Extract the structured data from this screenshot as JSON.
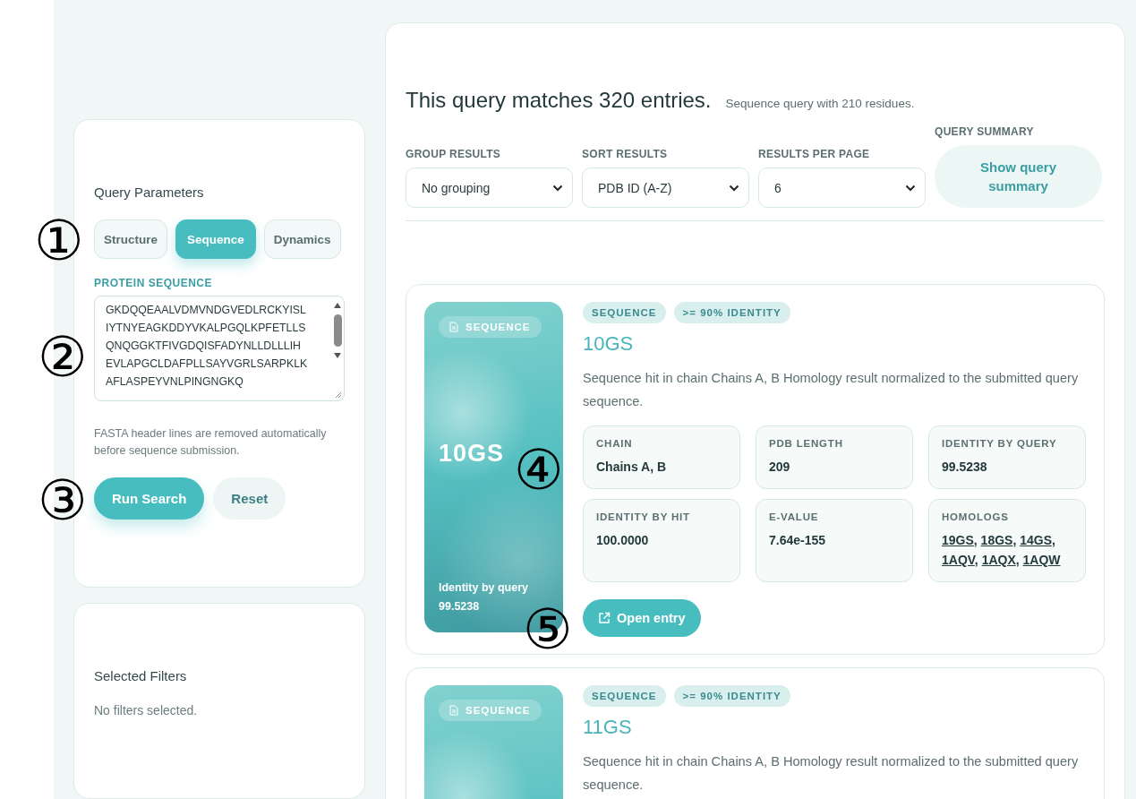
{
  "annotations": [
    "①",
    "②",
    "③",
    "④",
    "⑤"
  ],
  "query_panel": {
    "title": "Query Parameters",
    "modes": [
      {
        "label": "Structure",
        "selected": false
      },
      {
        "label": "Sequence",
        "selected": true
      },
      {
        "label": "Dynamics",
        "selected": false
      }
    ],
    "sequence_label": "PROTEIN SEQUENCE",
    "sequence_lines": [
      "GKDQQEAALVDMVNDGVEDLRCKYISL",
      "IYTNYEAGKDDYVKALPGQLKPFETLLS",
      "QNQGGKTFIVGDQISFADYNLLDLLLIH",
      "EVLAPGCLDAFPLLSAYVGRLSARPKLK",
      "AFLASPEYVNLPINGNGKQ"
    ],
    "hint": "FASTA header lines are removed automatically before sequence submission.",
    "buttons": [
      {
        "label": "Run Search",
        "kind": "primary"
      },
      {
        "label": "Reset",
        "kind": "secondary"
      }
    ]
  },
  "filters_panel": {
    "title": "Selected Filters",
    "empty_text": "No filters selected."
  },
  "results": {
    "headline": "This query matches 320 entries.",
    "subline": "Sequence query with 210 residues.",
    "controls": [
      {
        "label": "GROUP RESULTS",
        "value": "No grouping"
      },
      {
        "label": "SORT RESULTS",
        "value": "PDB ID (A-Z)"
      },
      {
        "label": "RESULTS PER PAGE",
        "value": "6"
      }
    ],
    "summary": {
      "label": "QUERY SUMMARY",
      "button": "Show query summary"
    },
    "entries": [
      {
        "art_badge": "SEQUENCE",
        "art_id": "10GS",
        "art_caption": "Identity by query",
        "art_value": "99.5238",
        "tags": [
          "SEQUENCE",
          ">= 90% IDENTITY"
        ],
        "id": "10GS",
        "description": "Sequence hit in chain Chains A, B Homology result normalized to the submitted query sequence.",
        "stats": [
          {
            "label": "CHAIN",
            "kind": "text",
            "value": "Chains A, B"
          },
          {
            "label": "PDB LENGTH",
            "kind": "text",
            "value": "209"
          },
          {
            "label": "IDENTITY BY QUERY",
            "kind": "text",
            "value": "99.5238"
          },
          {
            "label": "IDENTITY BY HIT",
            "kind": "text",
            "value": "100.0000"
          },
          {
            "label": "E-VALUE",
            "kind": "text",
            "value": "7.64e-155"
          },
          {
            "label": "HOMOLOGS",
            "kind": "links",
            "separator": ",",
            "links": [
              "19GS",
              "18GS",
              "14GS",
              "1AQV",
              "1AQX",
              "1AQW"
            ]
          }
        ],
        "button": "Open entry"
      },
      {
        "art_badge": "SEQUENCE",
        "tags": [
          "SEQUENCE",
          ">= 90% IDENTITY"
        ],
        "id": "11GS",
        "description": "Sequence hit in chain Chains A, B Homology result normalized to the submitted query sequence."
      }
    ]
  }
}
